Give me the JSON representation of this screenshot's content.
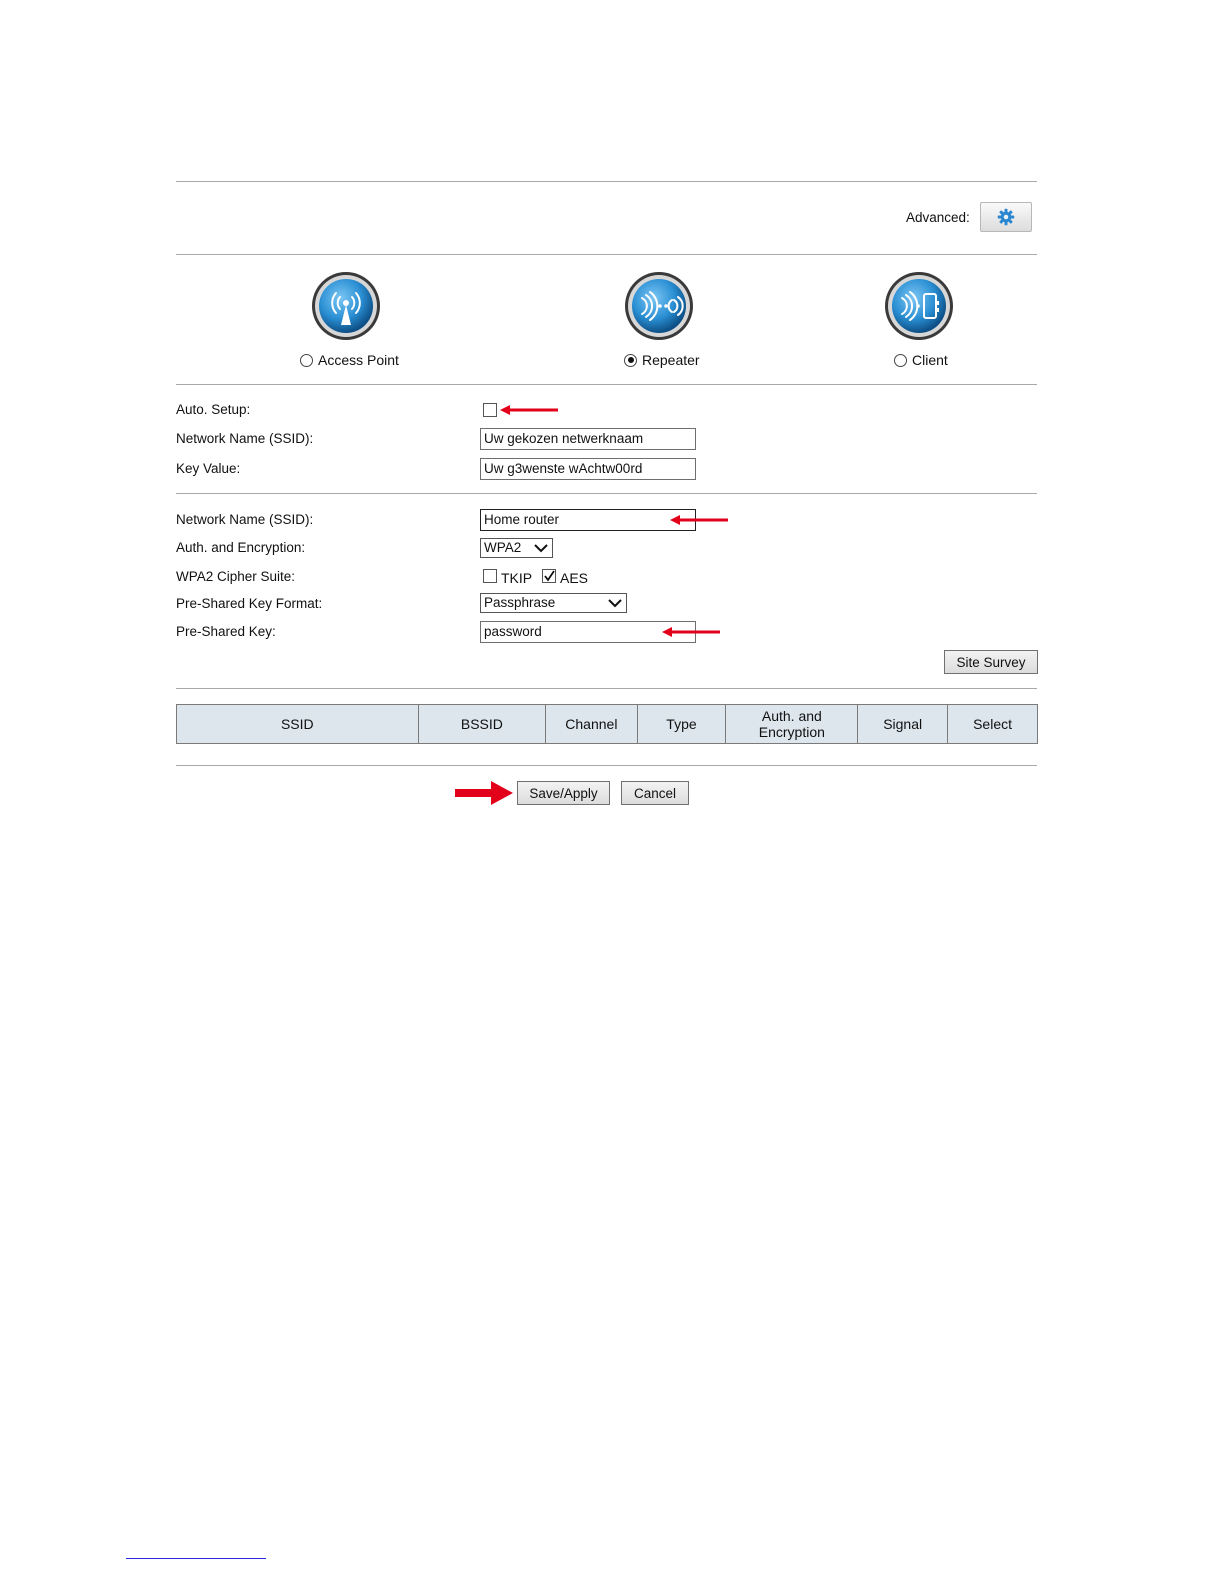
{
  "header": {
    "advanced_label": "Advanced:",
    "advanced_icon": "gear-icon"
  },
  "modes": [
    {
      "label": "Access Point",
      "icon": "access-point-icon",
      "selected": false
    },
    {
      "label": "Repeater",
      "icon": "repeater-icon",
      "selected": true
    },
    {
      "label": "Client",
      "icon": "client-icon",
      "selected": false
    }
  ],
  "local": {
    "auto_setup_label": "Auto. Setup:",
    "auto_setup_checked": false,
    "ssid_label": "Network Name (SSID):",
    "ssid_value": "Uw gekozen netwerknaam",
    "key_label": "Key Value:",
    "key_value": "Uw g3wenste wAchtw00rd"
  },
  "remote": {
    "ssid_label": "Network Name (SSID):",
    "ssid_value": "Home router",
    "auth_label": "Auth. and Encryption:",
    "auth_value": "WPA2",
    "cipher_label": "WPA2 Cipher Suite:",
    "tkip_label": "TKIP",
    "tkip_checked": false,
    "aes_label": "AES",
    "aes_checked": true,
    "psk_format_label": "Pre-Shared Key Format:",
    "psk_format_value": "Passphrase",
    "psk_label": "Pre-Shared Key:",
    "psk_value": "password",
    "site_survey_label": "Site Survey"
  },
  "survey_table": {
    "columns": [
      "SSID",
      "BSSID",
      "Channel",
      "Type",
      "Auth. and Encryption",
      "Signal",
      "Select"
    ]
  },
  "actions": {
    "save_label": "Save/Apply",
    "cancel_label": "Cancel"
  },
  "colors": {
    "annotation_arrow": "#e3001b",
    "icon_blue": "#2f8fd0",
    "table_header_bg": "#dde6ec"
  }
}
